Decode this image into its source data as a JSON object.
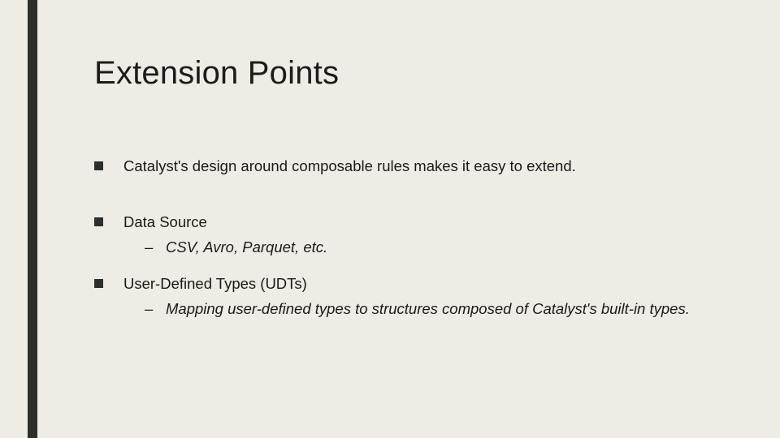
{
  "title": "Extension Points",
  "bullets": {
    "b0": {
      "text": "Catalyst's design around composable rules makes it easy to extend."
    },
    "b1": {
      "text": "Data Source",
      "sub": {
        "s0": "CSV, Avro, Parquet, etc."
      }
    },
    "b2": {
      "text": "User-Defined Types (UDTs)",
      "sub": {
        "s0": "Mapping user-defined types to structures composed of Catalyst's built-in types."
      }
    }
  }
}
